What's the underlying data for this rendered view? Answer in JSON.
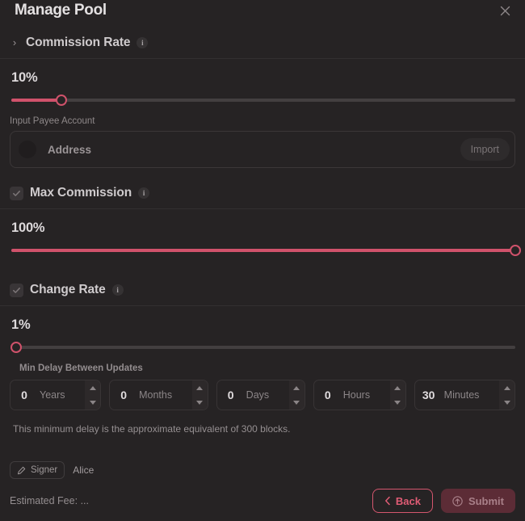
{
  "modal": {
    "title": "Manage Pool",
    "close_icon": "close-icon"
  },
  "commission_section": {
    "title": "Commission Rate",
    "chevron": "›",
    "info_icon": "i",
    "value_label": "10%",
    "slider_percent": 10,
    "payee_label": "Input Payee Account",
    "address_placeholder": "Address",
    "import_label": "Import"
  },
  "max_commission_section": {
    "title": "Max Commission",
    "info_icon": "i",
    "checked": true,
    "value_label": "100%",
    "slider_percent": 100
  },
  "change_rate_section": {
    "title": "Change Rate",
    "info_icon": "i",
    "checked": true,
    "value_label": "1%",
    "slider_percent": 1,
    "delay_label": "Min Delay Between Updates",
    "note": "This minimum delay is the approximate equivalent of 300 blocks.",
    "duration": [
      {
        "value": "0",
        "unit": "Years"
      },
      {
        "value": "0",
        "unit": "Months"
      },
      {
        "value": "0",
        "unit": "Days"
      },
      {
        "value": "0",
        "unit": "Hours"
      },
      {
        "value": "30",
        "unit": "Minutes"
      }
    ]
  },
  "footer": {
    "signer_label": "Signer",
    "signer_icon": "edit-pencil-icon",
    "signer_name": "Alice",
    "fee_label": "Estimated Fee:",
    "fee_value": "...",
    "back_label": "Back",
    "back_icon": "chevron-left-icon",
    "submit_label": "Submit",
    "submit_icon": "arrow-up-circle-icon"
  },
  "colors": {
    "accent": "#d0526b",
    "background": "#262324",
    "page_background": "#1c1a1b",
    "track": "#433f40",
    "submit_bg": "#5c2c36"
  }
}
